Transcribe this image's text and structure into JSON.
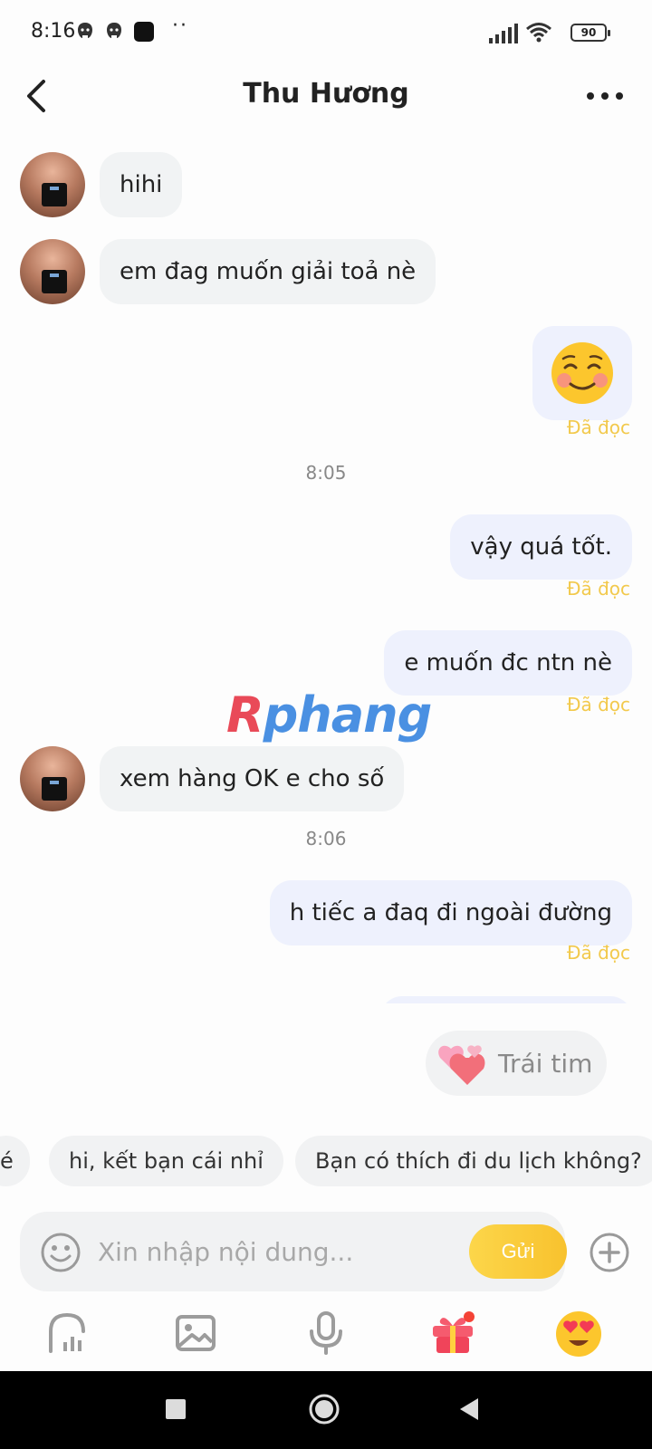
{
  "status": {
    "time": "8:16",
    "dots": "··",
    "battery": "90"
  },
  "header": {
    "title": "Thu Hương"
  },
  "messages": {
    "m1": "hihi",
    "m2": "em đag muốn giải toả nè",
    "m3_emoji": "☺",
    "m4": "vậy quá tốt.",
    "m5": "e muốn đc ntn nè",
    "m6": "xem hàng OK e cho số",
    "m7": "h tiếc a đaq đi ngoài đường"
  },
  "read_label": "Đã đọc",
  "timestamps": {
    "t1": "8:05",
    "t2": "8:06"
  },
  "watermark": {
    "first": "R",
    "rest": "phang"
  },
  "heart_chip": {
    "label": "Trái tim"
  },
  "quick_replies": {
    "q0": "é",
    "q1": "hi, kết bạn cái nhỉ",
    "q2": "Bạn có thích đi du lịch không?"
  },
  "composer": {
    "placeholder": "Xin nhập nội dung...",
    "send_label": "Gửi"
  },
  "colors": {
    "read": "#f2c94c",
    "send": "#f8c22e",
    "out_bubble": "#eef1fd",
    "in_bubble": "#f1f3f4"
  }
}
